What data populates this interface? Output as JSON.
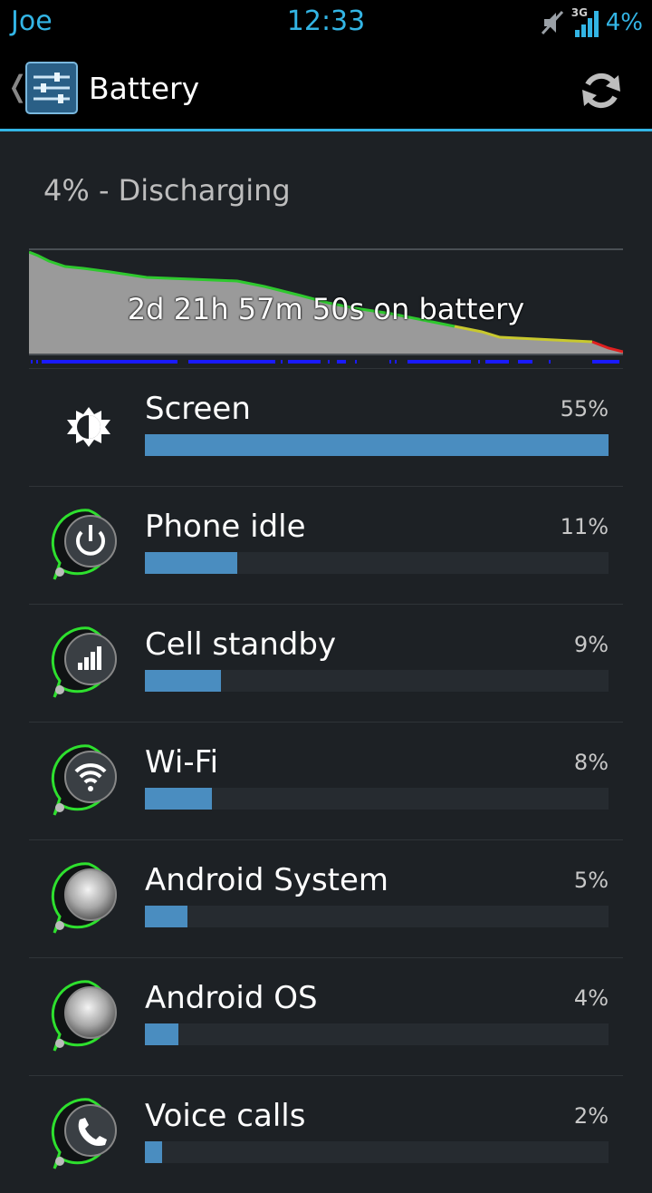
{
  "status_bar": {
    "carrier": "Joe",
    "time": "12:33",
    "network_type": "3G",
    "battery_percent": "4%",
    "icons": [
      "mute-icon",
      "signal-icon"
    ]
  },
  "action_bar": {
    "title": "Battery",
    "app_icon": "settings-sliders-icon",
    "refresh_icon": "refresh-icon"
  },
  "summary": "4% - Discharging",
  "graph": {
    "label": "2d 21h 57m 50s on battery"
  },
  "usage": [
    {
      "name": "Screen",
      "percent": "55%",
      "fraction": 0.55,
      "icon": "brightness-icon"
    },
    {
      "name": "Phone idle",
      "percent": "11%",
      "fraction": 0.11,
      "icon": "power-icon"
    },
    {
      "name": "Cell standby",
      "percent": "9%",
      "fraction": 0.09,
      "icon": "cell-signal-icon"
    },
    {
      "name": "Wi-Fi",
      "percent": "8%",
      "fraction": 0.08,
      "icon": "wifi-icon"
    },
    {
      "name": "Android System",
      "percent": "5%",
      "fraction": 0.05,
      "icon": "android-system-icon"
    },
    {
      "name": "Android OS",
      "percent": "4%",
      "fraction": 0.04,
      "icon": "android-os-icon"
    },
    {
      "name": "Voice calls",
      "percent": "2%",
      "fraction": 0.02,
      "icon": "phone-icon"
    }
  ],
  "colors": {
    "accent": "#33b5e5",
    "bar": "#4a8dc0",
    "graph_good": "#2ec82e",
    "graph_mid": "#c8c82e",
    "graph_low": "#e02020",
    "screen_on": "#1a1aff"
  }
}
